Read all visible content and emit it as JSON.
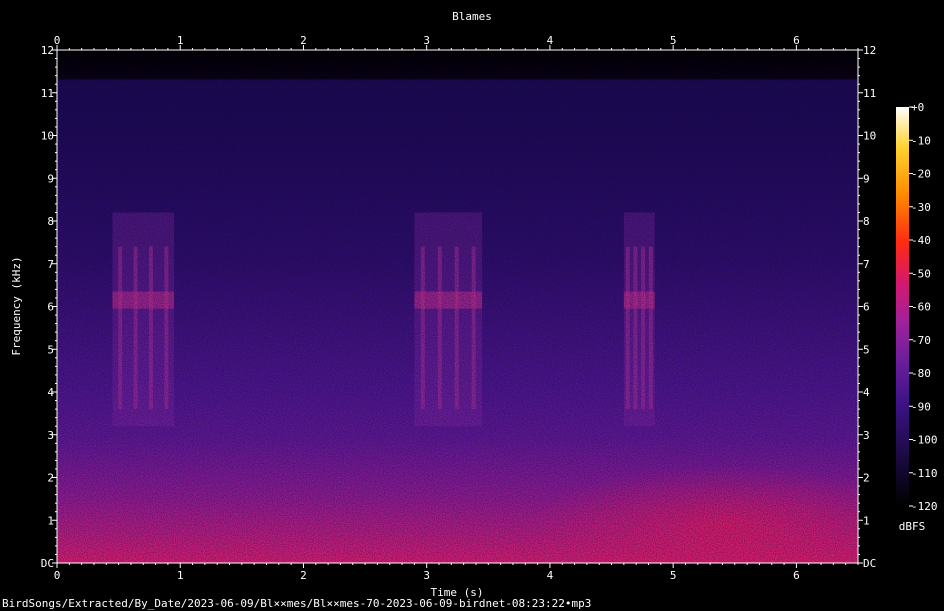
{
  "chart_data": {
    "type": "heatmap",
    "title": "Blames",
    "xlabel": "Time (s)",
    "ylabel": "Frequency (kHz)",
    "xlim": [
      0,
      6.5
    ],
    "ylim": [
      0,
      12
    ],
    "x_ticks": [
      "0",
      "1",
      "2",
      "3",
      "4",
      "5",
      "6"
    ],
    "y_ticks": [
      "DC",
      "1",
      "2",
      "3",
      "4",
      "5",
      "6",
      "7",
      "8",
      "9",
      "10",
      "11",
      "12"
    ],
    "colorbar": {
      "label": "dBFS",
      "range": [
        -120,
        0
      ],
      "ticks": [
        "+0",
        "-10",
        "-20",
        "-30",
        "-40",
        "-50",
        "-60",
        "-70",
        "-80",
        "-90",
        "-100",
        "-110",
        "-120"
      ]
    },
    "grid": false
  },
  "footer": {
    "path": "BirdSongs/Extracted/By_Date/2023-06-09/Bl××mes/Bl××mes-70-2023-06-09-birdnet-08:23:22•mp3"
  },
  "colors": {
    "background": "#000000",
    "axis": "#ffffff",
    "colormap": [
      "#000000",
      "#1a0a40",
      "#3a1284",
      "#6a1d9c",
      "#a0219c",
      "#d3196e",
      "#ff2a12",
      "#ff8a00",
      "#ffd430",
      "#ffffff"
    ]
  }
}
